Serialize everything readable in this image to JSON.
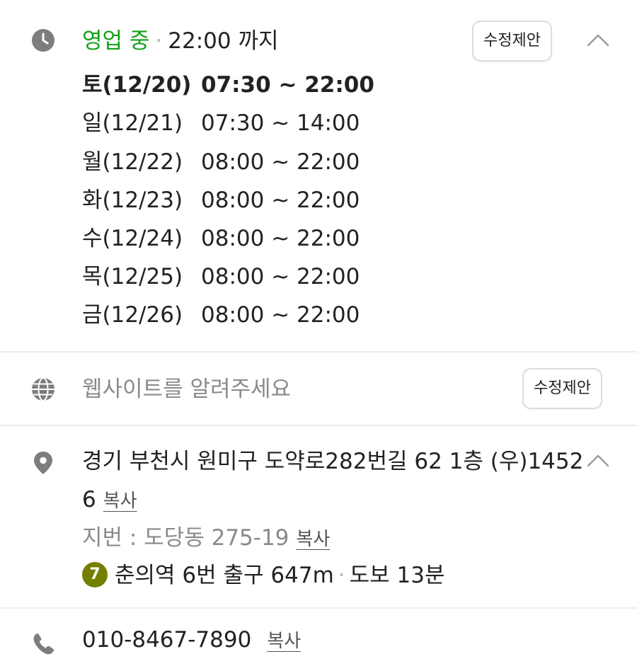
{
  "hours": {
    "status": "영업 중",
    "separator": "·",
    "closing": "22:00 까지",
    "suggest_label": "수정제안",
    "schedule": [
      {
        "day": "토(12/20)",
        "time": "07:30 ~ 22:00",
        "today": true
      },
      {
        "day": "일(12/21)",
        "time": "07:30 ~ 14:00",
        "today": false
      },
      {
        "day": "월(12/22)",
        "time": "08:00 ~ 22:00",
        "today": false
      },
      {
        "day": "화(12/23)",
        "time": "08:00 ~ 22:00",
        "today": false
      },
      {
        "day": "수(12/24)",
        "time": "08:00 ~ 22:00",
        "today": false
      },
      {
        "day": "목(12/25)",
        "time": "08:00 ~ 22:00",
        "today": false
      },
      {
        "day": "금(12/26)",
        "time": "08:00 ~ 22:00",
        "today": false
      }
    ]
  },
  "website": {
    "prompt": "웹사이트를 알려주세요",
    "suggest_label": "수정제안"
  },
  "address": {
    "line1": "경기 부천시 원미구 도약로282번길 62 1층 (우)1452",
    "line2": "6",
    "copy_label": "복사",
    "jibun_label": "지번 : 도당동 275-19",
    "jibun_copy_label": "복사",
    "subway_line": "7",
    "subway_color": "#747f00",
    "subway_text": "춘의역 6번 출구 647m",
    "walk_separator": "·",
    "walk_text": "도보 13분"
  },
  "phone": {
    "number": "010-8467-7890",
    "copy_label": "복사"
  },
  "colors": {
    "open_status": "#12a116",
    "icon_gray": "#7d7d7d",
    "divider": "#ececec"
  }
}
